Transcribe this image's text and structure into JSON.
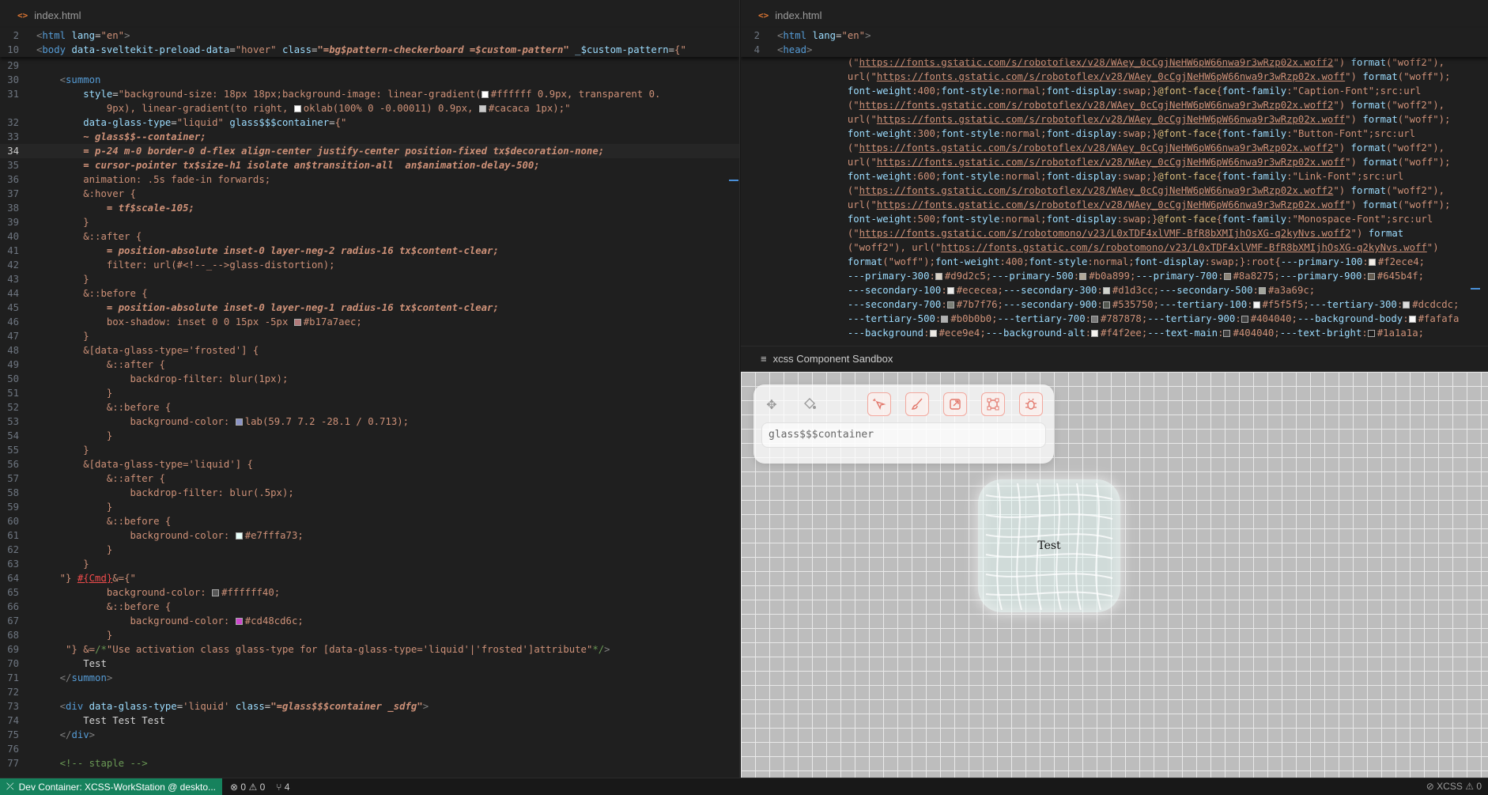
{
  "left_editor": {
    "tab_label": "index.html",
    "sticky": [
      {
        "n": "2",
        "h": "<span class=\"pn\">&lt;</span><span class=\"tg\">html</span> <span class=\"at\">lang</span>=<span class=\"st\">\"en\"</span><span class=\"pn\">&gt;</span>"
      },
      {
        "n": "10",
        "h": "<span class=\"pn\">&lt;</span><span class=\"tg\">body</span> <span class=\"at\">data-sveltekit-preload-data</span>=<span class=\"st\">\"hover\"</span> <span class=\"at\">class</span>=<span class=\"cl\">\"=bg$pattern-checkerboard =$custom-pattern\"</span> <span class=\"at\">_$custom-pattern</span>=<span class=\"st\">{\"</span>"
      }
    ],
    "lines": [
      {
        "n": "29",
        "h": ""
      },
      {
        "n": "30",
        "h": "    <span class=\"pn\">&lt;</span><span class=\"tg\">summon</span>"
      },
      {
        "n": "31",
        "h": "        <span class=\"at\">style</span>=<span class=\"st\">\"background-size: 18px 18px;background-image: linear-gradient(<span class=\"sw\" style=\"background:#ffffff\"></span>#ffffff 0.9px, transparent 0.</span>"
      },
      {
        "n": "",
        "h": "<span class=\"st\">            9px), linear-gradient(to right, <span class=\"sw\" style=\"background:#fff\"></span>oklab(100% 0 -0.00011) 0.9px, <span class=\"sw\" style=\"background:#cacaca\"></span>#cacaca 1px);\"</span>"
      },
      {
        "n": "32",
        "h": "        <span class=\"at\">data-glass-type</span>=<span class=\"st\">\"liquid\"</span> <span class=\"at\">glass$$$container</span>=<span class=\"st\">{\"</span>"
      },
      {
        "n": "33",
        "h": "        <span class=\"cl\">~ glass$$--container;</span>"
      },
      {
        "n": "34",
        "h": "        <span class=\"cl\">= p-24 m-0 border-0 d-flex align-center justify-center position-fixed tx$decoration-none;</span>",
        "cur": true
      },
      {
        "n": "35",
        "h": "        <span class=\"cl\">= cursor-pointer tx$size-h1 isolate an$transition-all  an$animation-delay-500;</span>"
      },
      {
        "n": "36",
        "h": "        <span class=\"st\">animation: .5s fade-in forwards;</span>"
      },
      {
        "n": "37",
        "h": "        <span class=\"st\">&amp;:hover {</span>"
      },
      {
        "n": "38",
        "h": "            <span class=\"cl\">= tf$scale-105;</span>"
      },
      {
        "n": "39",
        "h": "        <span class=\"st\">}</span>"
      },
      {
        "n": "40",
        "h": "        <span class=\"st\">&amp;::after {</span>"
      },
      {
        "n": "41",
        "h": "            <span class=\"cl\">= position-absolute inset-0 layer-neg-2 radius-16 tx$content-clear;</span>"
      },
      {
        "n": "42",
        "h": "            <span class=\"st\">filter: url(#&lt;!--_--&gt;glass-distortion);</span>"
      },
      {
        "n": "43",
        "h": "        <span class=\"st\">}</span>"
      },
      {
        "n": "44",
        "h": "        <span class=\"st\">&amp;::before {</span>"
      },
      {
        "n": "45",
        "h": "            <span class=\"cl\">= position-absolute inset-0 layer-neg-1 radius-16 tx$content-clear;</span>"
      },
      {
        "n": "46",
        "h": "            <span class=\"st\">box-shadow: inset 0 0 15px -5px <span class=\"sw\" style=\"background:#b17a7a\"></span>#b17a7aec;</span>"
      },
      {
        "n": "47",
        "h": "        <span class=\"st\">}</span>"
      },
      {
        "n": "48",
        "h": "        <span class=\"st\">&amp;[data-glass-type='frosted'] {</span>"
      },
      {
        "n": "49",
        "h": "            <span class=\"st\">&amp;::after {</span>"
      },
      {
        "n": "50",
        "h": "                <span class=\"st\">backdrop-filter: blur(1px);</span>"
      },
      {
        "n": "51",
        "h": "            <span class=\"st\">}</span>"
      },
      {
        "n": "52",
        "h": "            <span class=\"st\">&amp;::before {</span>"
      },
      {
        "n": "53",
        "h": "                <span class=\"st\">background-color: <span class=\"sw\" style=\"background:#8a93c6\"></span>lab(59.7 7.2 -28.1 / 0.713);</span>"
      },
      {
        "n": "54",
        "h": "            <span class=\"st\">}</span>"
      },
      {
        "n": "55",
        "h": "        <span class=\"st\">}</span>"
      },
      {
        "n": "56",
        "h": "        <span class=\"st\">&amp;[data-glass-type='liquid'] {</span>"
      },
      {
        "n": "57",
        "h": "            <span class=\"st\">&amp;::after {</span>"
      },
      {
        "n": "58",
        "h": "                <span class=\"st\">backdrop-filter: blur(.5px);</span>"
      },
      {
        "n": "59",
        "h": "            <span class=\"st\">}</span>"
      },
      {
        "n": "60",
        "h": "            <span class=\"st\">&amp;::before {</span>"
      },
      {
        "n": "61",
        "h": "                <span class=\"st\">background-color: <span class=\"sw\" style=\"background:#e7fffa\"></span>#e7fffa73;</span>"
      },
      {
        "n": "62",
        "h": "            <span class=\"st\">}</span>"
      },
      {
        "n": "63",
        "h": "        <span class=\"st\">}</span>"
      },
      {
        "n": "64",
        "h": "    <span class=\"st\">\"}</span> <span class=\"st\" style=\"color:#f14c4c;text-decoration:underline\">#{Cmd}</span><span class=\"st\">&amp;={\"</span>"
      },
      {
        "n": "65",
        "h": "            <span class=\"st\">background-color: <span class=\"sw\" style=\"background:#ffffff40\"></span>#ffffff40;</span>"
      },
      {
        "n": "66",
        "h": "            <span class=\"st\">&amp;::before {</span>"
      },
      {
        "n": "67",
        "h": "                <span class=\"st\">background-color: <span class=\"sw\" style=\"background:#cd48cd\"></span>#cd48cd6c;</span>"
      },
      {
        "n": "68",
        "h": "            <span class=\"st\">}</span>"
      },
      {
        "n": "69",
        "h": "     <span class=\"st\">\"}</span> <span class=\"st\">&amp;=</span><span class=\"ct\">/*</span><span class=\"st\">\"Use activation class glass-type for [data-glass-type='liquid'|'frosted']attribute\"</span><span class=\"ct\">*/</span><span class=\"pn\">&gt;</span>"
      },
      {
        "n": "70",
        "h": "        <span class=\"tx\">Test</span>"
      },
      {
        "n": "71",
        "h": "    <span class=\"pn\">&lt;/</span><span class=\"tg\">summon</span><span class=\"pn\">&gt;</span>"
      },
      {
        "n": "72",
        "h": ""
      },
      {
        "n": "73",
        "h": "    <span class=\"pn\">&lt;</span><span class=\"tg\">div</span> <span class=\"at\">data-glass-type</span>=<span class=\"st\">'liquid'</span> <span class=\"at\">class</span>=<span class=\"cl\">\"=glass$$$container _sdfg\"</span><span class=\"pn\">&gt;</span>"
      },
      {
        "n": "74",
        "h": "        <span class=\"tx\">Test Test Test</span>"
      },
      {
        "n": "75",
        "h": "    <span class=\"pn\">&lt;/</span><span class=\"tg\">div</span><span class=\"pn\">&gt;</span>"
      },
      {
        "n": "76",
        "h": ""
      },
      {
        "n": "77",
        "h": "    <span class=\"ct\">&lt;!-- staple --&gt;</span>"
      }
    ]
  },
  "right_editor": {
    "tab_label": "index.html",
    "sticky": [
      {
        "n": "2",
        "h": "<span class=\"pn\">&lt;</span><span class=\"tg\">html</span> <span class=\"at\">lang</span>=<span class=\"st\">\"en\"</span><span class=\"pn\">&gt;</span>"
      },
      {
        "n": "4",
        "h": "<span class=\"pn\">&lt;</span><span class=\"tg\">head</span><span class=\"pn\">&gt;</span>"
      }
    ],
    "lines": [
      {
        "h": "            <span class=\"st\">(\"<span class=\"url\">https://fonts.gstatic.com/s/robotoflex/v28/WAey_0cCgjNeHW6pW66nwa9r3wRzp02x.woff2</span>\")</span> <span class=\"at\">format</span><span class=\"st\">(\"woff2\"),</span>"
      },
      {
        "h": "            <span class=\"st\">url(\"<span class=\"url\">https://fonts.gstatic.com/s/robotoflex/v28/WAey_0cCgjNeHW6pW66nwa9r3wRzp02x.woff</span>\")</span> <span class=\"at\">format</span><span class=\"st\">(\"woff\");</span>"
      },
      {
        "h": "            <span class=\"at\">font-weight</span><span class=\"st\">:400;</span><span class=\"at\">font-style</span><span class=\"st\">:normal;</span><span class=\"at\">font-display</span><span class=\"st\">:swap;}</span><span class=\"kw\">@font-face</span><span class=\"st\">{</span><span class=\"at\">font-family</span><span class=\"st\">:\"Caption-Font\";src:url</span>"
      },
      {
        "h": "            <span class=\"st\">(\"<span class=\"url\">https://fonts.gstatic.com/s/robotoflex/v28/WAey_0cCgjNeHW6pW66nwa9r3wRzp02x.woff2</span>\")</span> <span class=\"at\">format</span><span class=\"st\">(\"woff2\"),</span>"
      },
      {
        "h": "            <span class=\"st\">url(\"<span class=\"url\">https://fonts.gstatic.com/s/robotoflex/v28/WAey_0cCgjNeHW6pW66nwa9r3wRzp02x.woff</span>\")</span> <span class=\"at\">format</span><span class=\"st\">(\"woff\");</span>"
      },
      {
        "h": "            <span class=\"at\">font-weight</span><span class=\"st\">:300;</span><span class=\"at\">font-style</span><span class=\"st\">:normal;</span><span class=\"at\">font-display</span><span class=\"st\">:swap;}</span><span class=\"kw\">@font-face</span><span class=\"st\">{</span><span class=\"at\">font-family</span><span class=\"st\">:\"Button-Font\";src:url</span>"
      },
      {
        "h": "            <span class=\"st\">(\"<span class=\"url\">https://fonts.gstatic.com/s/robotoflex/v28/WAey_0cCgjNeHW6pW66nwa9r3wRzp02x.woff2</span>\")</span> <span class=\"at\">format</span><span class=\"st\">(\"woff2\"),</span>"
      },
      {
        "h": "            <span class=\"st\">url(\"<span class=\"url\">https://fonts.gstatic.com/s/robotoflex/v28/WAey_0cCgjNeHW6pW66nwa9r3wRzp02x.woff</span>\")</span> <span class=\"at\">format</span><span class=\"st\">(\"woff\");</span>"
      },
      {
        "h": "            <span class=\"at\">font-weight</span><span class=\"st\">:600;</span><span class=\"at\">font-style</span><span class=\"st\">:normal;</span><span class=\"at\">font-display</span><span class=\"st\">:swap;}</span><span class=\"kw\">@font-face</span><span class=\"st\">{</span><span class=\"at\">font-family</span><span class=\"st\">:\"Link-Font\";src:url</span>"
      },
      {
        "h": "            <span class=\"st\">(\"<span class=\"url\">https://fonts.gstatic.com/s/robotoflex/v28/WAey_0cCgjNeHW6pW66nwa9r3wRzp02x.woff2</span>\")</span> <span class=\"at\">format</span><span class=\"st\">(\"woff2\"),</span>"
      },
      {
        "h": "            <span class=\"st\">url(\"<span class=\"url\">https://fonts.gstatic.com/s/robotoflex/v28/WAey_0cCgjNeHW6pW66nwa9r3wRzp02x.woff</span>\")</span> <span class=\"at\">format</span><span class=\"st\">(\"woff\");</span>"
      },
      {
        "h": "            <span class=\"at\">font-weight</span><span class=\"st\">:500;</span><span class=\"at\">font-style</span><span class=\"st\">:normal;</span><span class=\"at\">font-display</span><span class=\"st\">:swap;}</span><span class=\"kw\">@font-face</span><span class=\"st\">{</span><span class=\"at\">font-family</span><span class=\"st\">:\"Monospace-Font\";src:url</span>"
      },
      {
        "h": "            <span class=\"st\">(\"<span class=\"url\">https://fonts.gstatic.com/s/robotomono/v23/L0xTDF4xlVMF-BfR8bXMIjhOsXG-q2kyNvs.woff2</span>\")</span> <span class=\"at\">format</span>"
      },
      {
        "h": "            <span class=\"st\">(\"woff2\"), url(\"<span class=\"url\">https://fonts.gstatic.com/s/robotomono/v23/L0xTDF4xlVMF-BfR8bXMIjhOsXG-q2kyNvs.woff</span>\")</span>"
      },
      {
        "h": "            <span class=\"at\">format</span><span class=\"st\">(\"woff\");</span><span class=\"at\">font-weight</span><span class=\"st\">:400;</span><span class=\"at\">font-style</span><span class=\"st\">:normal;</span><span class=\"at\">font-display</span><span class=\"st\">:swap;}:root{</span><span class=\"at\">---primary-100</span><span class=\"st\">:<span class=\"sw\" style=\"background:#f2ece4\"></span>#f2ece4;</span>"
      },
      {
        "h": "            <span class=\"at\">---primary-300</span><span class=\"st\">:<span class=\"sw\" style=\"background:#d9d2c5\"></span>#d9d2c5;</span><span class=\"at\">---primary-500</span><span class=\"st\">:<span class=\"sw\" style=\"background:#b0a899\"></span>#b0a899;</span><span class=\"at\">---primary-700</span><span class=\"st\">:<span class=\"sw\" style=\"background:#8a8275\"></span>#8a8275;</span><span class=\"at\">---primary-900</span><span class=\"st\">:<span class=\"sw\" style=\"background:#645b4f\"></span>#645b4f;</span>"
      },
      {
        "h": "            <span class=\"at\">---secondary-100</span><span class=\"st\">:<span class=\"sw\" style=\"background:#ececea\"></span>#ececea;</span><span class=\"at\">---secondary-300</span><span class=\"st\">:<span class=\"sw\" style=\"background:#d1d3cc\"></span>#d1d3cc;</span><span class=\"at\">---secondary-500</span><span class=\"st\">:<span class=\"sw\" style=\"background:#a3a69c\"></span>#a3a69c;</span>"
      },
      {
        "h": "            <span class=\"at\">---secondary-700</span><span class=\"st\">:<span class=\"sw\" style=\"background:#7b7f76\"></span>#7b7f76;</span><span class=\"at\">---secondary-900</span><span class=\"st\">:<span class=\"sw\" style=\"background:#535750\"></span>#535750;</span><span class=\"at\">---tertiary-100</span><span class=\"st\">:<span class=\"sw\" style=\"background:#f5f5f5\"></span>#f5f5f5;</span><span class=\"at\">---tertiary-300</span><span class=\"st\">:<span class=\"sw\" style=\"background:#dcdcdc\"></span>#dcdcdc;</span>"
      },
      {
        "h": "            <span class=\"at\">---tertiary-500</span><span class=\"st\">:<span class=\"sw\" style=\"background:#b0b0b0\"></span>#b0b0b0;</span><span class=\"at\">---tertiary-700</span><span class=\"st\">:<span class=\"sw\" style=\"background:#787878\"></span>#787878;</span><span class=\"at\">---tertiary-900</span><span class=\"st\">:<span class=\"sw\" style=\"background:#404040\"></span>#404040;</span><span class=\"at\">---background-body</span><span class=\"st\">:<span class=\"sw\" style=\"background:#fafafa\"></span>#fafafa</span>"
      },
      {
        "h": "            <span class=\"at\">---background</span><span class=\"st\">:<span class=\"sw\" style=\"background:#ece9e4\"></span>#ece9e4;</span><span class=\"at\">---background-alt</span><span class=\"st\">:<span class=\"sw\" style=\"background:#f4f2ee\"></span>#f4f2ee;</span><span class=\"at\">---text-main</span><span class=\"st\">:<span class=\"sw\" style=\"background:#404040\"></span>#404040;</span><span class=\"at\">---text-bright</span><span class=\"st\">:<span class=\"sw\" style=\"background:#1a1a1a\"></span>#1a1a1a;</span>"
      }
    ]
  },
  "sandbox": {
    "panel_title": "xcss Component Sandbox",
    "selector_input": "glass$$$container",
    "glass_text": "Test",
    "tools": [
      "move-icon",
      "paint-bucket-icon",
      "cursor-sparkle-icon",
      "brush-icon",
      "external-link-icon",
      "bounding-box-icon",
      "bug-icon"
    ]
  },
  "statusbar": {
    "remote": "Dev Container: XCSS-WorkStation @ deskto...",
    "errors": "0",
    "warnings": "0",
    "ports": "4",
    "right": "XCSS",
    "right_count": "0"
  }
}
